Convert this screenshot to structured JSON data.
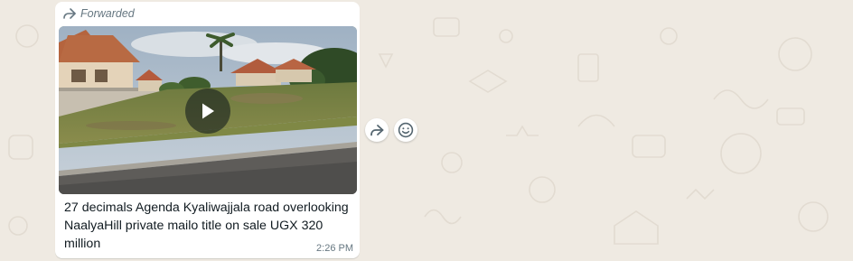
{
  "message": {
    "forwarded_label": "Forwarded",
    "caption": "27 decimals Agenda Kyaliwajjala road overlooking NaalyaHill private mailo title on sale UGX 320 million",
    "time": "2:26 PM"
  },
  "icons": {
    "forwarded": "forward-arrow-icon",
    "play": "play-icon",
    "forward_action": "forward-icon",
    "react_action": "emoji-icon"
  },
  "colors": {
    "chat_background": "#efeae2",
    "bubble": "#ffffff",
    "meta_text": "#667781",
    "text": "#111b21"
  }
}
